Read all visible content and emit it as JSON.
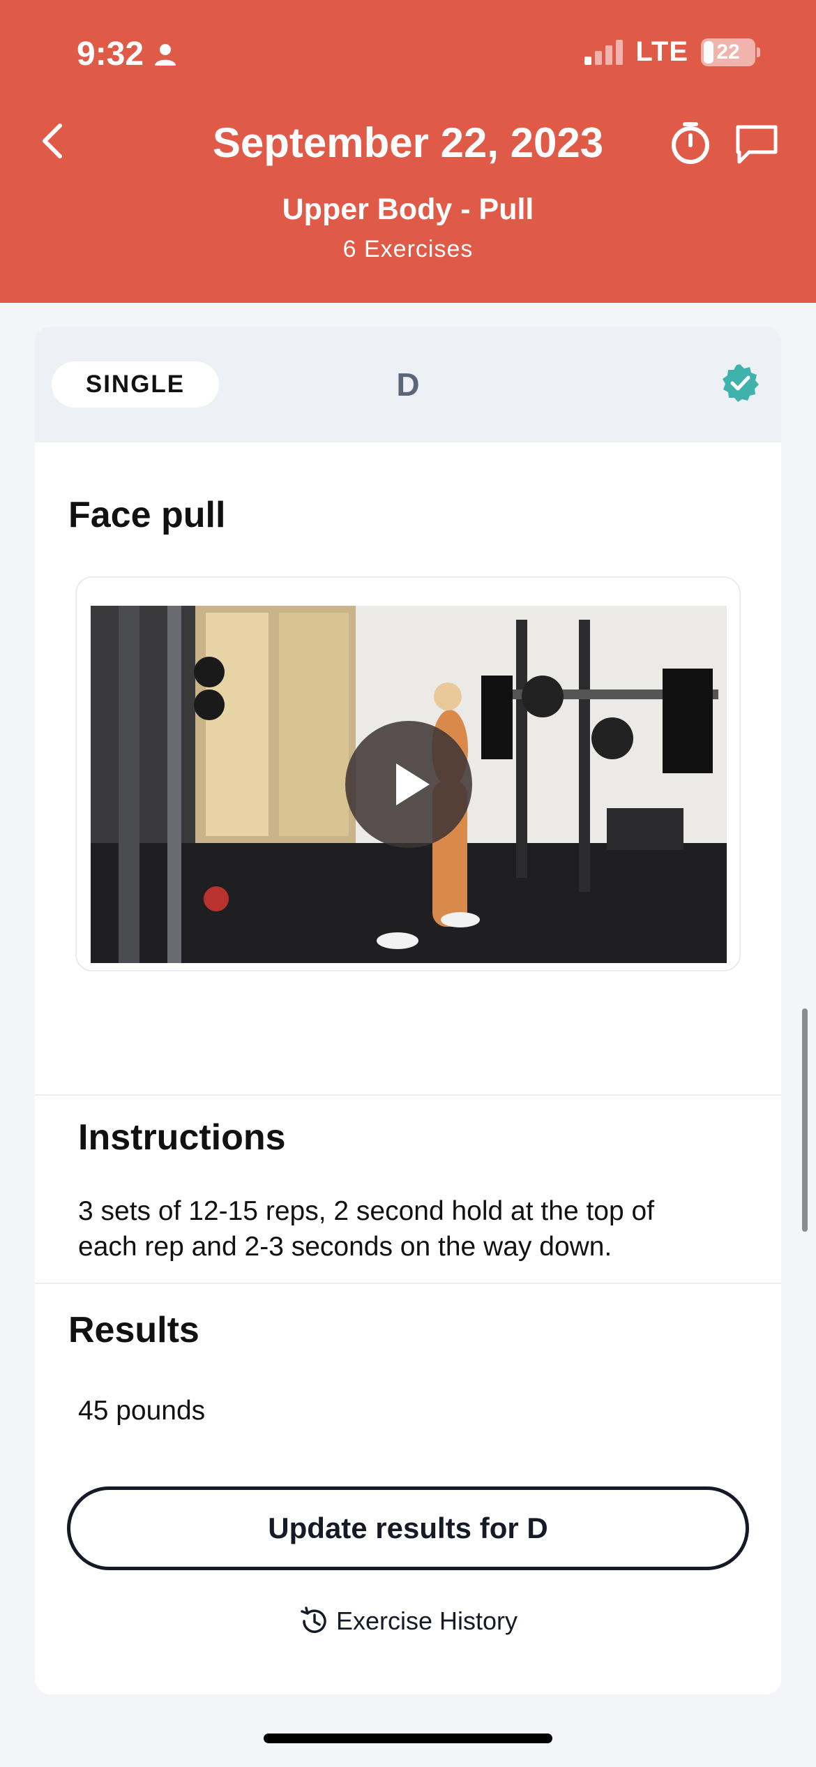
{
  "status_bar": {
    "time": "9:32",
    "network": "LTE",
    "battery": "22"
  },
  "header": {
    "title": "September 22, 2023",
    "workout_name": "Upper Body - Pull",
    "exercise_count": "6 Exercises"
  },
  "card": {
    "type_pill": "SINGLE",
    "letter": "D",
    "exercise_name": "Face pull",
    "instructions_title": "Instructions",
    "instructions_line1": "3 sets of 12-15 reps, 2 second hold at the top of",
    "instructions_line2": "each rep and 2-3 seconds on the way down.",
    "results_title": "Results",
    "results_value": "45 pounds",
    "update_button": "Update results for D",
    "history_link": "Exercise History"
  },
  "colors": {
    "accent": "#e05a48",
    "check": "#3fb3ab",
    "button_border": "#161a26"
  }
}
